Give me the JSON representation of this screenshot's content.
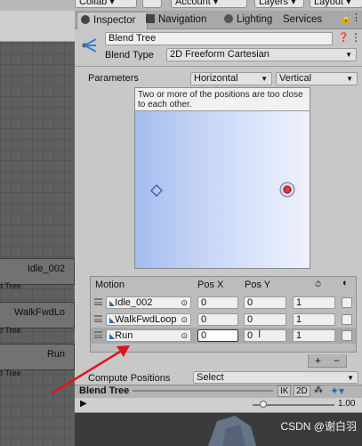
{
  "toolbar": {
    "collab": "Collab",
    "account": "Account",
    "layers": "Layers",
    "layout": "Layout"
  },
  "tabs": [
    {
      "label": "Inspector",
      "active": true
    },
    {
      "label": "Navigation"
    },
    {
      "label": "Lighting"
    },
    {
      "label": "Services"
    }
  ],
  "graph": {
    "nodes": [
      "Idle_002",
      "WalkFwdLo",
      "Run"
    ],
    "node_sub": [
      "d Tree",
      "d Tree",
      "d Tree"
    ],
    "strip_label": "Blend Tree"
  },
  "inspector": {
    "name": "Blend Tree",
    "blend_type_label": "Blend Type",
    "blend_type": "2D Freeform Cartesian",
    "parameters_label": "Parameters",
    "param_x": "Horizontal",
    "param_y": "Vertical",
    "warning": "Two or more of the positions are too close to each other.",
    "columns": {
      "motion": "Motion",
      "pos_x": "Pos X",
      "pos_y": "Pos Y"
    },
    "motions": [
      {
        "name": "Idle_002",
        "pos_x": "0",
        "pos_y": "0",
        "speed": "1"
      },
      {
        "name": "WalkFwdLoop",
        "pos_x": "0",
        "pos_y": "0",
        "speed": "1"
      },
      {
        "name": "Run",
        "pos_x": "0",
        "pos_y": "0",
        "speed": "1"
      }
    ],
    "add_label": "+",
    "remove_label": "−",
    "compute_label": "Compute Positions",
    "compute_value": "Select"
  },
  "preview": {
    "title": "Blend Tree",
    "ik": "IK",
    "two_d": "2D",
    "speed": "1.00",
    "watermark": "CSDN @谢白羽"
  },
  "colors": {
    "arrow": "#e0141e",
    "point_marker": "#e23b3b",
    "plot_gradient_left": "#a5bdf0"
  }
}
